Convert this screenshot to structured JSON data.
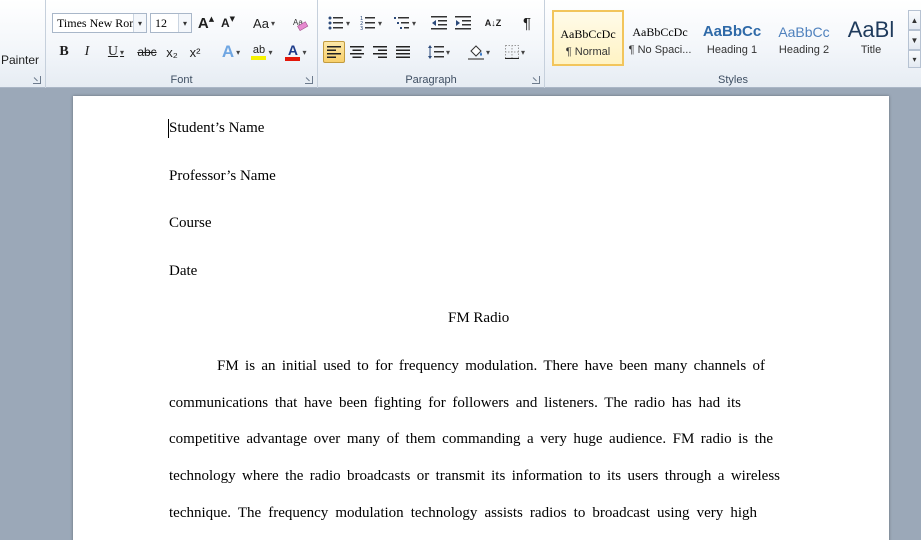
{
  "clipboard": {
    "format_painter_label": "Painter"
  },
  "font": {
    "group_label": "Font",
    "font_name": "Times New Rom",
    "font_size": "12",
    "grow_label": "A",
    "shrink_label": "A",
    "change_case_label": "Aa",
    "bold_label": "B",
    "italic_label": "I",
    "underline_label": "U",
    "strike_label": "abc",
    "subscript_label": "x₂",
    "superscript_label": "x²",
    "text_effects_label": "A",
    "highlight_label": "ab",
    "font_color_label": "A",
    "font_color": "#e3170a",
    "highlight_color": "#f5f200"
  },
  "paragraph": {
    "group_label": "Paragraph",
    "show_marks_label": "¶",
    "sort_label": "A↓Z"
  },
  "styles": {
    "group_label": "Styles",
    "items": [
      {
        "sample": "AaBbCcDc",
        "name": "¶ Normal"
      },
      {
        "sample": "AaBbCcDc",
        "name": "¶ No Spaci..."
      },
      {
        "sample": "AaBbCc",
        "name": "Heading 1"
      },
      {
        "sample": "AaBbCc",
        "name": "Heading 2"
      },
      {
        "sample": "AaBl",
        "name": "Title"
      }
    ],
    "heading_color": "#2f6aa8",
    "heading2_color": "#4f81bd"
  },
  "document": {
    "lines": [
      "Student’s Name",
      "Professor’s Name",
      "Course",
      "Date"
    ],
    "title": "FM Radio",
    "body": [
      "FM is an initial used to for frequency modulation. There have been many channels of",
      "communications that have been fighting for followers and listeners.  The radio has had its",
      "competitive advantage over many of them commanding a very huge audience. FM radio is the",
      "technology where the radio broadcasts or transmit its information to its users through a wireless",
      "technique. The frequency modulation technology assists radios to broadcast using very high"
    ]
  }
}
